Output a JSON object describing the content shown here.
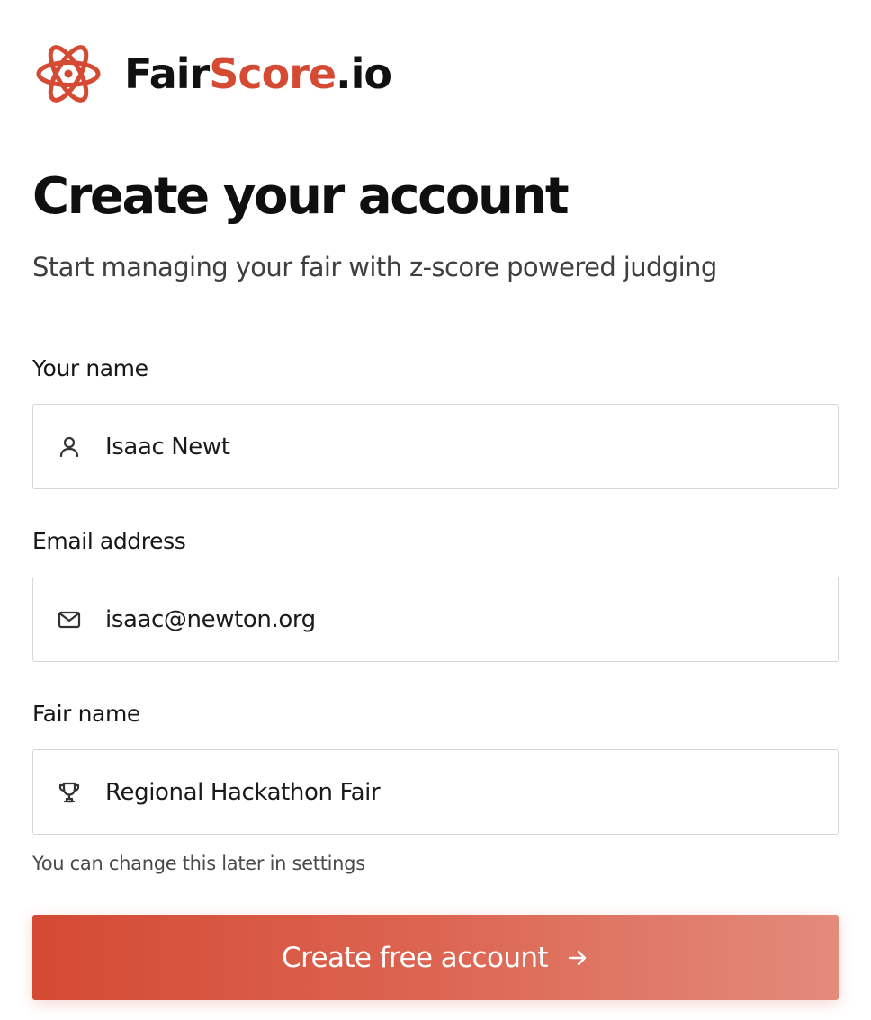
{
  "brand": {
    "name_part1": "Fair",
    "name_part2": "Score",
    "name_part3": ".io",
    "logo_icon": "atom-icon",
    "accent_color": "#d44a33"
  },
  "header": {
    "title": "Create your account",
    "subtitle": "Start managing your fair with z-score powered judging"
  },
  "form": {
    "name": {
      "label": "Your name",
      "value": "Isaac Newt",
      "icon": "user-icon"
    },
    "email": {
      "label": "Email address",
      "value": "isaac@newton.org",
      "icon": "mail-icon"
    },
    "fair": {
      "label": "Fair name",
      "value": "Regional Hackathon Fair",
      "icon": "trophy-icon",
      "helper": "You can change this later in settings"
    },
    "submit": {
      "label": "Create free account",
      "icon": "arrow-right-icon"
    }
  }
}
